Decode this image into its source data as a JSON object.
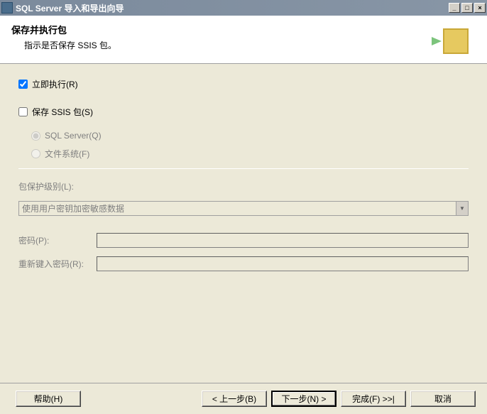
{
  "window": {
    "title": "SQL Server 导入和导出向导"
  },
  "header": {
    "title": "保存并执行包",
    "subtitle": "指示是否保存 SSIS 包。"
  },
  "options": {
    "run_immediately": "立即执行(R)",
    "save_ssis": "保存 SSIS 包(S)",
    "sql_server": "SQL Server(Q)",
    "file_system": "文件系统(F)"
  },
  "protection": {
    "label": "包保护级别(L):",
    "value": "使用用户密钥加密敏感数据"
  },
  "password": {
    "label": "密码(P):",
    "retype_label": "重新键入密码(R):"
  },
  "buttons": {
    "help": "帮助(H)",
    "back": "< 上一步(B)",
    "next": "下一步(N) >",
    "finish": "完成(F) >>|",
    "cancel": "取消"
  }
}
